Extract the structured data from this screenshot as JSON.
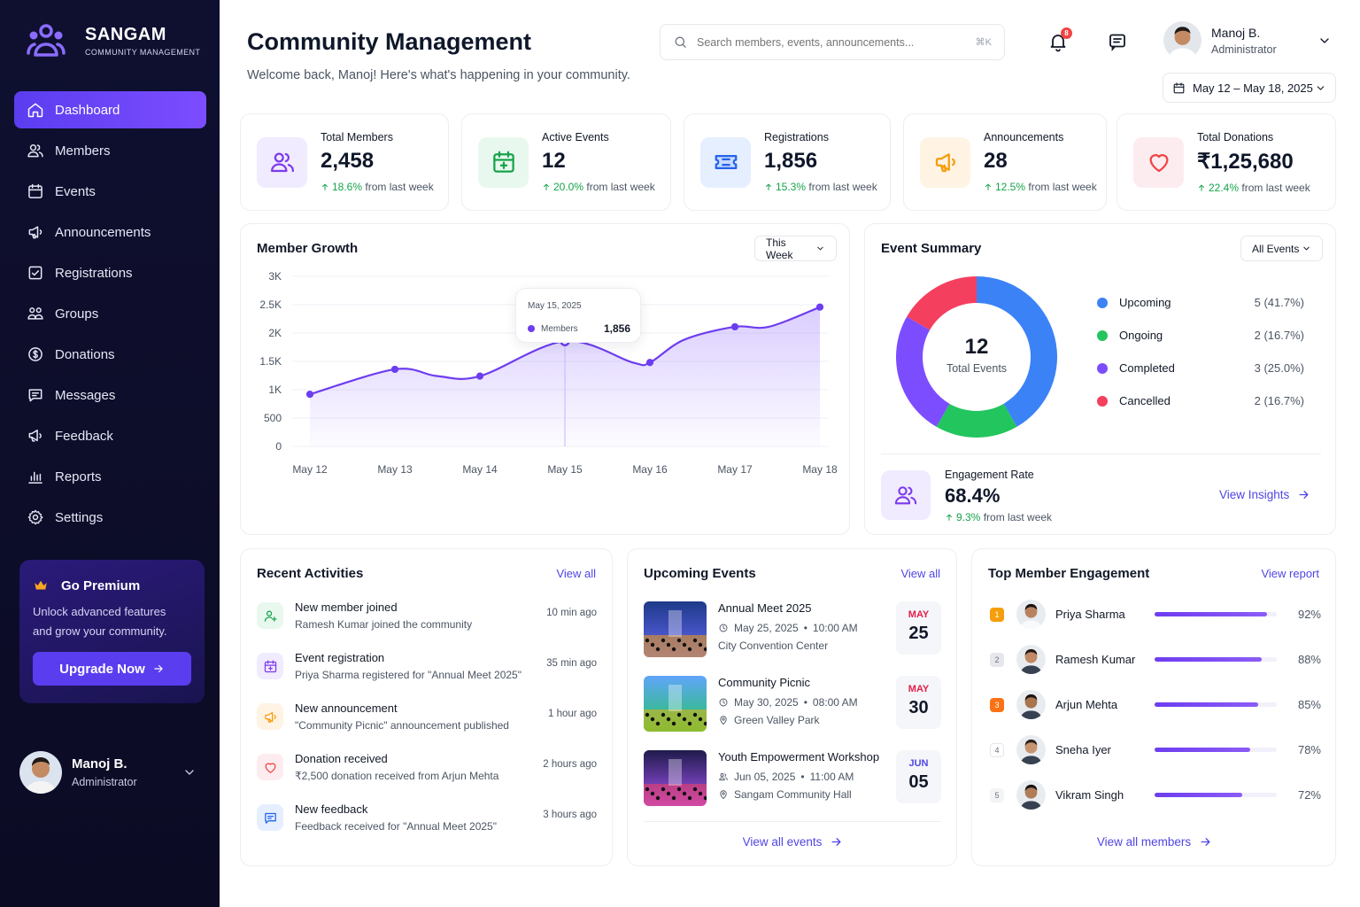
{
  "brand": {
    "name": "SANGAM",
    "tagline": "COMMUNITY MANAGEMENT"
  },
  "nav": [
    {
      "label": "Dashboard",
      "icon": "home-icon",
      "active": true
    },
    {
      "label": "Members",
      "icon": "members-icon"
    },
    {
      "label": "Events",
      "icon": "calendar-icon"
    },
    {
      "label": "Announcements",
      "icon": "megaphone-icon"
    },
    {
      "label": "Registrations",
      "icon": "registration-icon"
    },
    {
      "label": "Groups",
      "icon": "groups-icon"
    },
    {
      "label": "Donations",
      "icon": "donation-icon"
    },
    {
      "label": "Messages",
      "icon": "message-icon"
    },
    {
      "label": "Feedback",
      "icon": "feedback-icon"
    },
    {
      "label": "Reports",
      "icon": "reports-icon"
    },
    {
      "label": "Settings",
      "icon": "gear-icon"
    }
  ],
  "premium": {
    "title": "Go Premium",
    "text1": "Unlock advanced features",
    "text2": "and grow your community.",
    "button": "Upgrade Now"
  },
  "user": {
    "name": "Manoj B.",
    "role": "Administrator"
  },
  "header": {
    "title": "Community Management",
    "subtitle": "Welcome back, Manoj! Here's what's happening in your community.",
    "search_placeholder": "Search members, events, announcements...",
    "search_shortcut": "⌘K",
    "notifications": "8",
    "date_range": "May 12 – May 18, 2025"
  },
  "stats": [
    {
      "label": "Total Members",
      "value": "2,458",
      "delta": "18.6%",
      "suffix": "from last week",
      "icon": "members-icon",
      "color": "#7c3aed",
      "bg": "#f0ebff"
    },
    {
      "label": "Active Events",
      "value": "12",
      "delta": "20.0%",
      "suffix": "from last week",
      "icon": "calendar-icon",
      "color": "#16a34a",
      "bg": "#e8f8ee"
    },
    {
      "label": "Registrations",
      "value": "1,856",
      "delta": "15.3%",
      "suffix": "from last week",
      "icon": "ticket-icon",
      "color": "#2563eb",
      "bg": "#e6efff"
    },
    {
      "label": "Announcements",
      "value": "28",
      "delta": "12.5%",
      "suffix": "from last week",
      "icon": "megaphone-icon",
      "color": "#f59e0b",
      "bg": "#fff3e4"
    },
    {
      "label": "Total Donations",
      "value": "₹1,25,680",
      "delta": "22.4%",
      "suffix": "from last week",
      "icon": "heart-icon",
      "color": "#ef4444",
      "bg": "#fdecef"
    }
  ],
  "growth": {
    "title": "Member Growth",
    "filter": "This Week",
    "tooltip": {
      "date": "May 15, 2025",
      "label": "Members",
      "value": "1,856"
    }
  },
  "chart_data": {
    "type": "area",
    "x": [
      "May 12",
      "May 13",
      "May 14",
      "May 15",
      "May 16",
      "May 17",
      "May 18"
    ],
    "series": [
      {
        "name": "Members",
        "x": [
          "May 12",
          "May 13",
          "May 13.5",
          "May 14",
          "May 15",
          "May 15.8",
          "May 16",
          "May 16.4",
          "May 17",
          "May 17.4",
          "May 18"
        ],
        "values": [
          920,
          1360,
          1240,
          1240,
          1856,
          1480,
          1480,
          1880,
          2110,
          2110,
          2458
        ]
      }
    ],
    "yticks": [
      "3K",
      "2.5K",
      "2K",
      "1.5K",
      "1K",
      "500",
      "0"
    ],
    "ylim": [
      0,
      3000
    ],
    "grid": true
  },
  "event_summary": {
    "title": "Event Summary",
    "filter": "All Events",
    "total": "12",
    "total_label": "Total Events",
    "items": [
      {
        "label": "Upcoming",
        "value": "5 (41.7%)",
        "count": 5,
        "color": "#3b82f6"
      },
      {
        "label": "Ongoing",
        "value": "2 (16.7%)",
        "count": 2,
        "color": "#22c55e"
      },
      {
        "label": "Completed",
        "value": "3 (25.0%)",
        "count": 3,
        "color": "#7c4dff"
      },
      {
        "label": "Cancelled",
        "value": "2 (16.7%)",
        "count": 2,
        "color": "#f43f5e"
      }
    ],
    "engagement": {
      "label": "Engagement Rate",
      "value": "68.4%",
      "delta": "9.3%",
      "suffix": "from last week",
      "link": "View Insights"
    }
  },
  "activities": {
    "title": "Recent Activities",
    "link": "View all",
    "items": [
      {
        "title": "New member joined",
        "desc": "Ramesh Kumar joined the community",
        "time": "10 min ago",
        "icon": "user-plus-icon",
        "color": "#16a34a",
        "bg": "#e8f8ee"
      },
      {
        "title": "Event registration",
        "desc": "Priya Sharma registered for \"Annual Meet 2025\"",
        "time": "35 min ago",
        "icon": "calendar-icon",
        "color": "#7c3aed",
        "bg": "#f0ebff"
      },
      {
        "title": "New announcement",
        "desc": "\"Community Picnic\" announcement published",
        "time": "1 hour ago",
        "icon": "megaphone-icon",
        "color": "#f59e0b",
        "bg": "#fff3e4"
      },
      {
        "title": "Donation received",
        "desc": "₹2,500 donation received from Arjun Mehta",
        "time": "2 hours ago",
        "icon": "heart-icon",
        "color": "#ef4444",
        "bg": "#fdecef"
      },
      {
        "title": "New feedback",
        "desc": "Feedback received for \"Annual Meet 2025\"",
        "time": "3 hours ago",
        "icon": "message-icon",
        "color": "#2563eb",
        "bg": "#e6efff"
      }
    ]
  },
  "events": {
    "title": "Upcoming Events",
    "link": "View all",
    "footer": "View all events",
    "items": [
      {
        "title": "Annual Meet 2025",
        "date": "May 25, 2025",
        "time": "10:00 AM",
        "place": "City Convention Center",
        "month": "MAY",
        "day": "25",
        "month_color": "#e11d48",
        "meta_icon": "clock-icon"
      },
      {
        "title": "Community Picnic",
        "date": "May 30, 2025",
        "time": "08:00 AM",
        "place": "Green Valley Park",
        "month": "MAY",
        "day": "30",
        "month_color": "#e11d48",
        "meta_icon": "clock-icon"
      },
      {
        "title": "Youth Empowerment Workshop",
        "date": "Jun 05, 2025",
        "time": "11:00 AM",
        "place": "Sangam Community Hall",
        "month": "JUN",
        "day": "05",
        "month_color": "#4f46e5",
        "meta_icon": "users-icon"
      }
    ]
  },
  "engagement": {
    "title": "Top Member Engagement",
    "link": "View report",
    "footer": "View all members",
    "items": [
      {
        "rank": "1",
        "name": "Priya Sharma",
        "pct": "92%",
        "value": 0.92,
        "rank_bg": "#f59e0b",
        "rank_fg": "#ffffff"
      },
      {
        "rank": "2",
        "name": "Ramesh Kumar",
        "pct": "88%",
        "value": 0.88,
        "rank_bg": "#e5e7eb",
        "rank_fg": "#6b7280"
      },
      {
        "rank": "3",
        "name": "Arjun Mehta",
        "pct": "85%",
        "value": 0.85,
        "rank_bg": "#f97316",
        "rank_fg": "#ffffff"
      },
      {
        "rank": "4",
        "name": "Sneha Iyer",
        "pct": "78%",
        "value": 0.78,
        "rank_bg": "#ffffff",
        "rank_fg": "#6b7280"
      },
      {
        "rank": "5",
        "name": "Vikram Singh",
        "pct": "72%",
        "value": 0.72,
        "rank_bg": "#f3f4f6",
        "rank_fg": "#6b7280"
      }
    ]
  }
}
